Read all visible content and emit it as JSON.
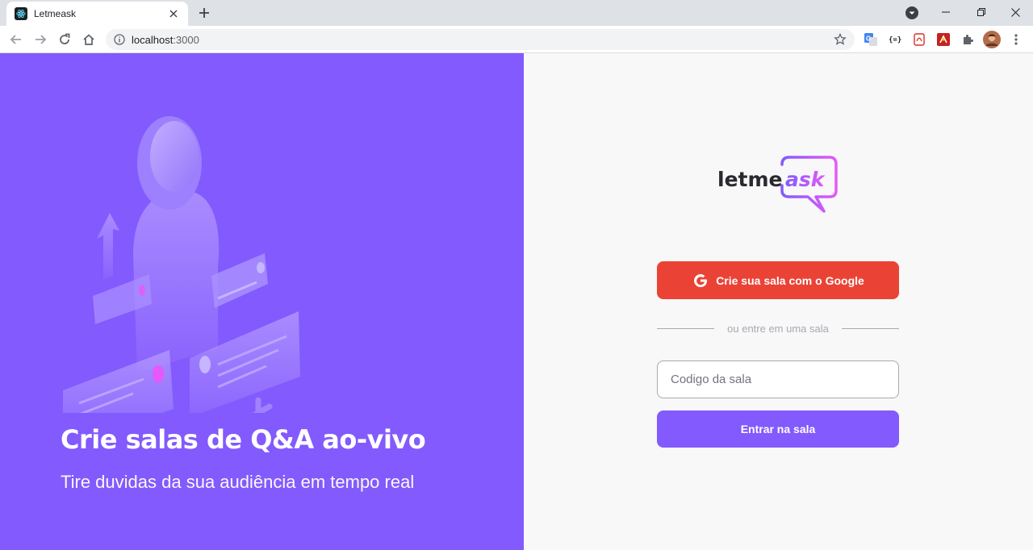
{
  "browser": {
    "tab_title": "Letmeask",
    "url_host": "localhost",
    "url_port": ":3000"
  },
  "aside": {
    "title": "Crie salas de Q&A ao-vivo",
    "subtitle": "Tire duvidas da sua audiência em tempo real"
  },
  "main": {
    "logo_text_1": "letme",
    "logo_text_2": "ask",
    "google_button_label": "Crie sua sala com o Google",
    "separator_label": "ou entre em uma sala",
    "room_code_placeholder": "Codigo da sala",
    "room_code_value": "",
    "enter_button_label": "Entrar na sala"
  },
  "colors": {
    "brand_purple": "#835afd",
    "google_red": "#ea4335",
    "logo_pink": "#e559f9"
  }
}
